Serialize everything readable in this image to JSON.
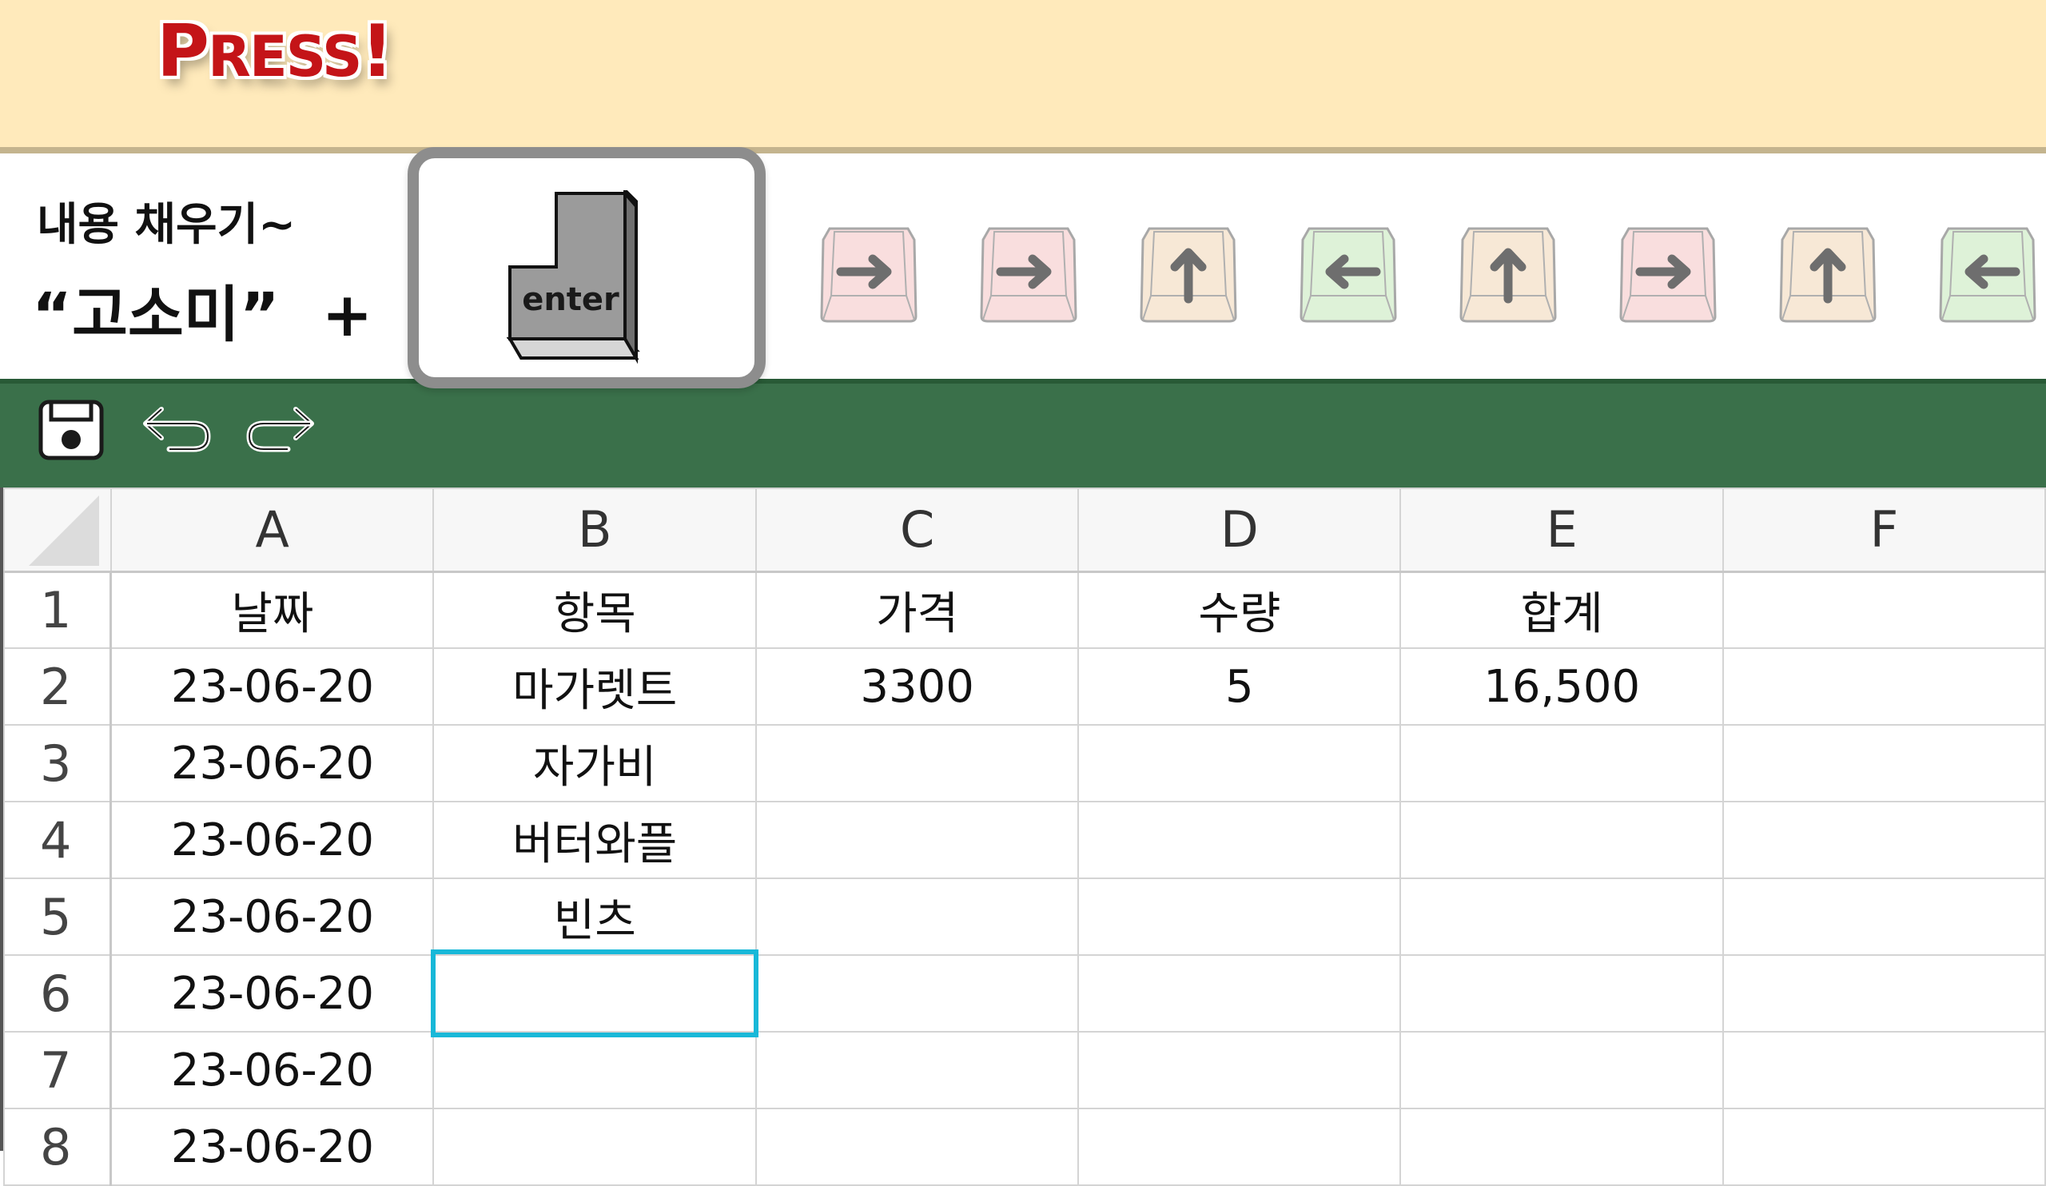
{
  "banner": {
    "press_big": "P",
    "press_small": "RESS",
    "press_end": "!"
  },
  "instruction": {
    "line1": "내용 채우기~",
    "line2": "“고소미”  +"
  },
  "enter_key": {
    "label": "enter"
  },
  "key_sequence": [
    {
      "direction": "right",
      "icon": "arrow-right-icon",
      "color": "#f9dede"
    },
    {
      "direction": "right",
      "icon": "arrow-right-icon",
      "color": "#f9dede"
    },
    {
      "direction": "up",
      "icon": "arrow-up-icon",
      "color": "#f7e8d6"
    },
    {
      "direction": "left",
      "icon": "arrow-left-icon",
      "color": "#def2d8"
    },
    {
      "direction": "up",
      "icon": "arrow-up-icon",
      "color": "#f7e8d6"
    },
    {
      "direction": "right",
      "icon": "arrow-right-icon",
      "color": "#f9dede"
    },
    {
      "direction": "up",
      "icon": "arrow-up-icon",
      "color": "#f7e8d6"
    },
    {
      "direction": "left",
      "icon": "arrow-left-icon",
      "color": "#def2d8"
    }
  ],
  "toolbar": {
    "icons": [
      "save-icon",
      "undo-icon",
      "redo-icon"
    ],
    "color": "#3a704a"
  },
  "sheet": {
    "columns": [
      "A",
      "B",
      "C",
      "D",
      "E",
      "F"
    ],
    "rows": [
      {
        "num": "1",
        "cells": [
          "날짜",
          "항목",
          "가격",
          "수량",
          "합계",
          ""
        ]
      },
      {
        "num": "2",
        "cells": [
          "23-06-20",
          "마가렛트",
          "3300",
          "5",
          "16,500",
          ""
        ]
      },
      {
        "num": "3",
        "cells": [
          "23-06-20",
          "자가비",
          "",
          "",
          "",
          ""
        ]
      },
      {
        "num": "4",
        "cells": [
          "23-06-20",
          "버터와플",
          "",
          "",
          "",
          ""
        ]
      },
      {
        "num": "5",
        "cells": [
          "23-06-20",
          "빈츠",
          "",
          "",
          "",
          ""
        ]
      },
      {
        "num": "6",
        "cells": [
          "23-06-20",
          "",
          "",
          "",
          "",
          ""
        ]
      },
      {
        "num": "7",
        "cells": [
          "23-06-20",
          "",
          "",
          "",
          "",
          ""
        ]
      },
      {
        "num": "8",
        "cells": [
          "23-06-20",
          "",
          "",
          "",
          "",
          ""
        ]
      }
    ],
    "selected_cell": "B6",
    "selection_color": "#18b8d8"
  }
}
